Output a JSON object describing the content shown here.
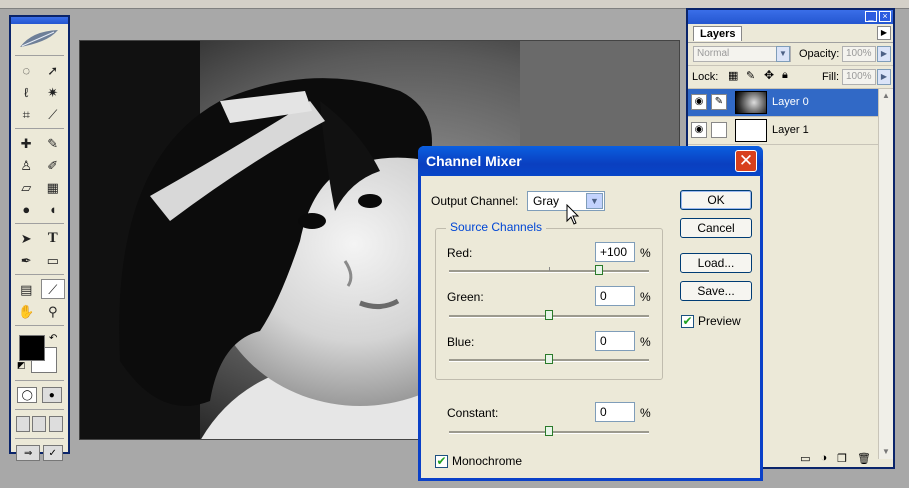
{
  "layers_panel": {
    "tab": "Layers",
    "blend_mode": "Normal",
    "opacity_label": "Opacity:",
    "opacity_value": "100%",
    "lock_label": "Lock:",
    "fill_label": "Fill:",
    "fill_value": "100%",
    "layers": [
      {
        "name": "Layer 0",
        "selected": true
      },
      {
        "name": "Layer 1",
        "selected": false
      }
    ]
  },
  "dialog": {
    "title": "Channel Mixer",
    "output_channel_label": "Output Channel:",
    "output_channel_value": "Gray",
    "source_channels_label": "Source Channels",
    "red_label": "Red:",
    "red_value": "+100",
    "green_label": "Green:",
    "green_value": "0",
    "blue_label": "Blue:",
    "blue_value": "0",
    "constant_label": "Constant:",
    "constant_value": "0",
    "percent": "%",
    "monochrome_label": "Monochrome",
    "monochrome_checked": true,
    "preview_label": "Preview",
    "preview_checked": true,
    "buttons": {
      "ok": "OK",
      "cancel": "Cancel",
      "load": "Load...",
      "save": "Save..."
    },
    "slider_range": [
      -200,
      200
    ]
  },
  "colors": {
    "titlebar_blue": "#0a40c8",
    "close_red": "#d8401c",
    "dialog_bg": "#ece9d8",
    "layer_selected": "#3169c6",
    "group_title": "#0046d5"
  }
}
